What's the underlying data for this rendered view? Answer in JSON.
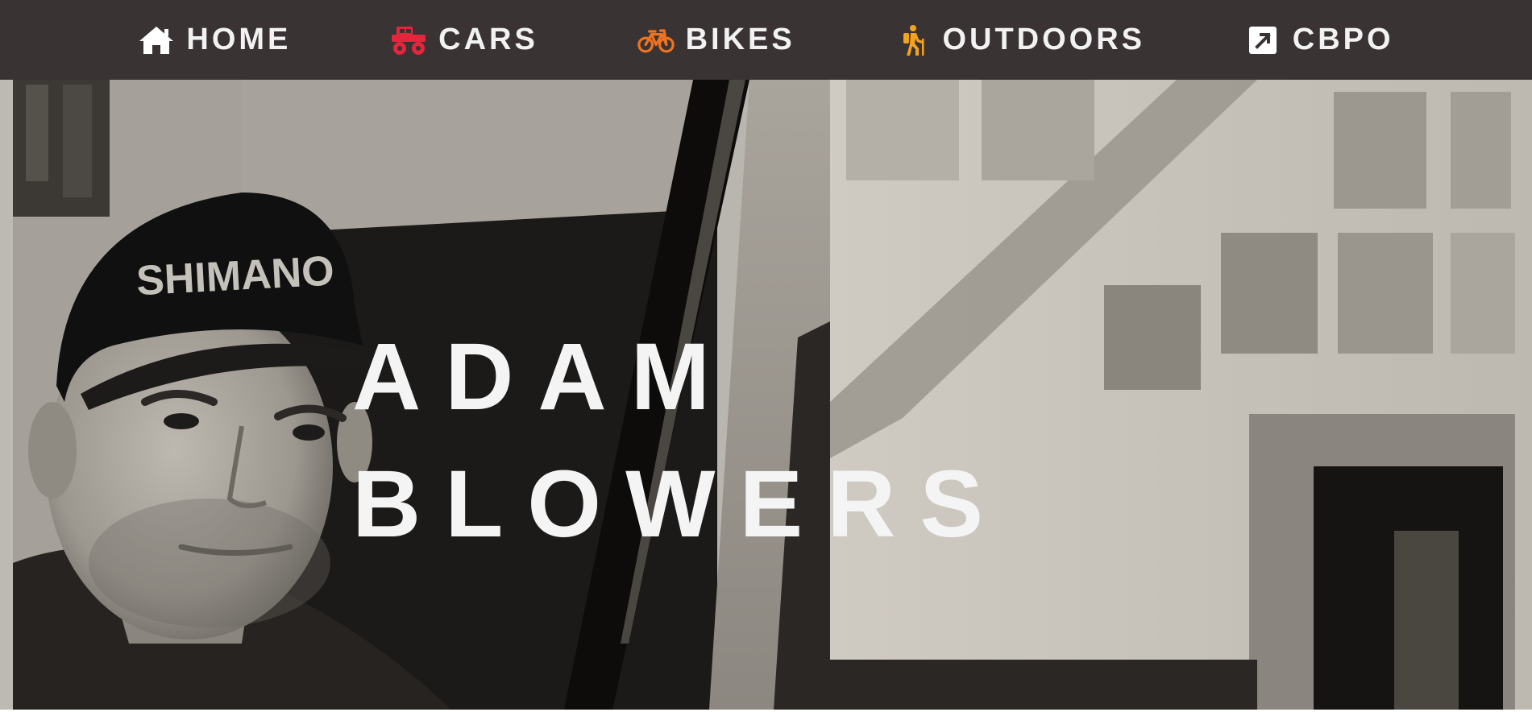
{
  "nav": {
    "items": [
      {
        "label": "HOME",
        "icon": "home-icon",
        "color": "#ffffff"
      },
      {
        "label": "CARS",
        "icon": "monster-truck-icon",
        "color": "#e3263c"
      },
      {
        "label": "BIKES",
        "icon": "bicycle-icon",
        "color": "#f0731f"
      },
      {
        "label": "OUTDOORS",
        "icon": "hiking-icon",
        "color": "#f3a31f"
      },
      {
        "label": "CBPO",
        "icon": "external-link-icon",
        "color": "#ffffff"
      }
    ]
  },
  "hero": {
    "first_name": "ADAM",
    "last_name": "BLOWERS",
    "photo_cap_text": "SHIMANO"
  }
}
